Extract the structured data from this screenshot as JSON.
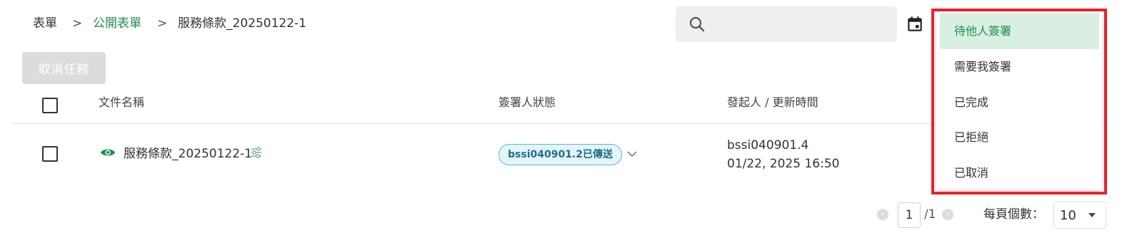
{
  "breadcrumb": {
    "items": [
      "表單",
      "公開表單",
      "服務條款_20250122-1"
    ],
    "separator": ">"
  },
  "search": {
    "value": "",
    "placeholder": ""
  },
  "toolbar": {
    "cancel_task_label": "取消任務"
  },
  "table": {
    "columns": [
      "文件名稱",
      "簽署人狀態",
      "發起人 / 更新時間"
    ],
    "rows": [
      {
        "file_name": "服務條款_20250122-1",
        "signer_status": "bssi040901.2已傳送",
        "sender": "bssi040901.4",
        "updated_at": "01/22, 2025 16:50"
      }
    ]
  },
  "pagination": {
    "current_page": "1",
    "total_label": "/1",
    "per_page_label": "每頁個數：",
    "per_page_value": "10"
  },
  "filter_menu": {
    "items": [
      "待他人簽署",
      "需要我簽署",
      "已完成",
      "已拒絕",
      "已取消"
    ],
    "selected": "待他人簽署"
  },
  "colors": {
    "accent_green": "#1e8f4e",
    "highlight_red": "#e8232a",
    "badge_blue": "#5ab7cf"
  },
  "icons": [
    "search-icon",
    "calendar-icon",
    "eye-icon",
    "flow-icon",
    "chevron-down-icon",
    "chevron-left-icon",
    "chevron-right-icon",
    "caret-down-icon"
  ]
}
